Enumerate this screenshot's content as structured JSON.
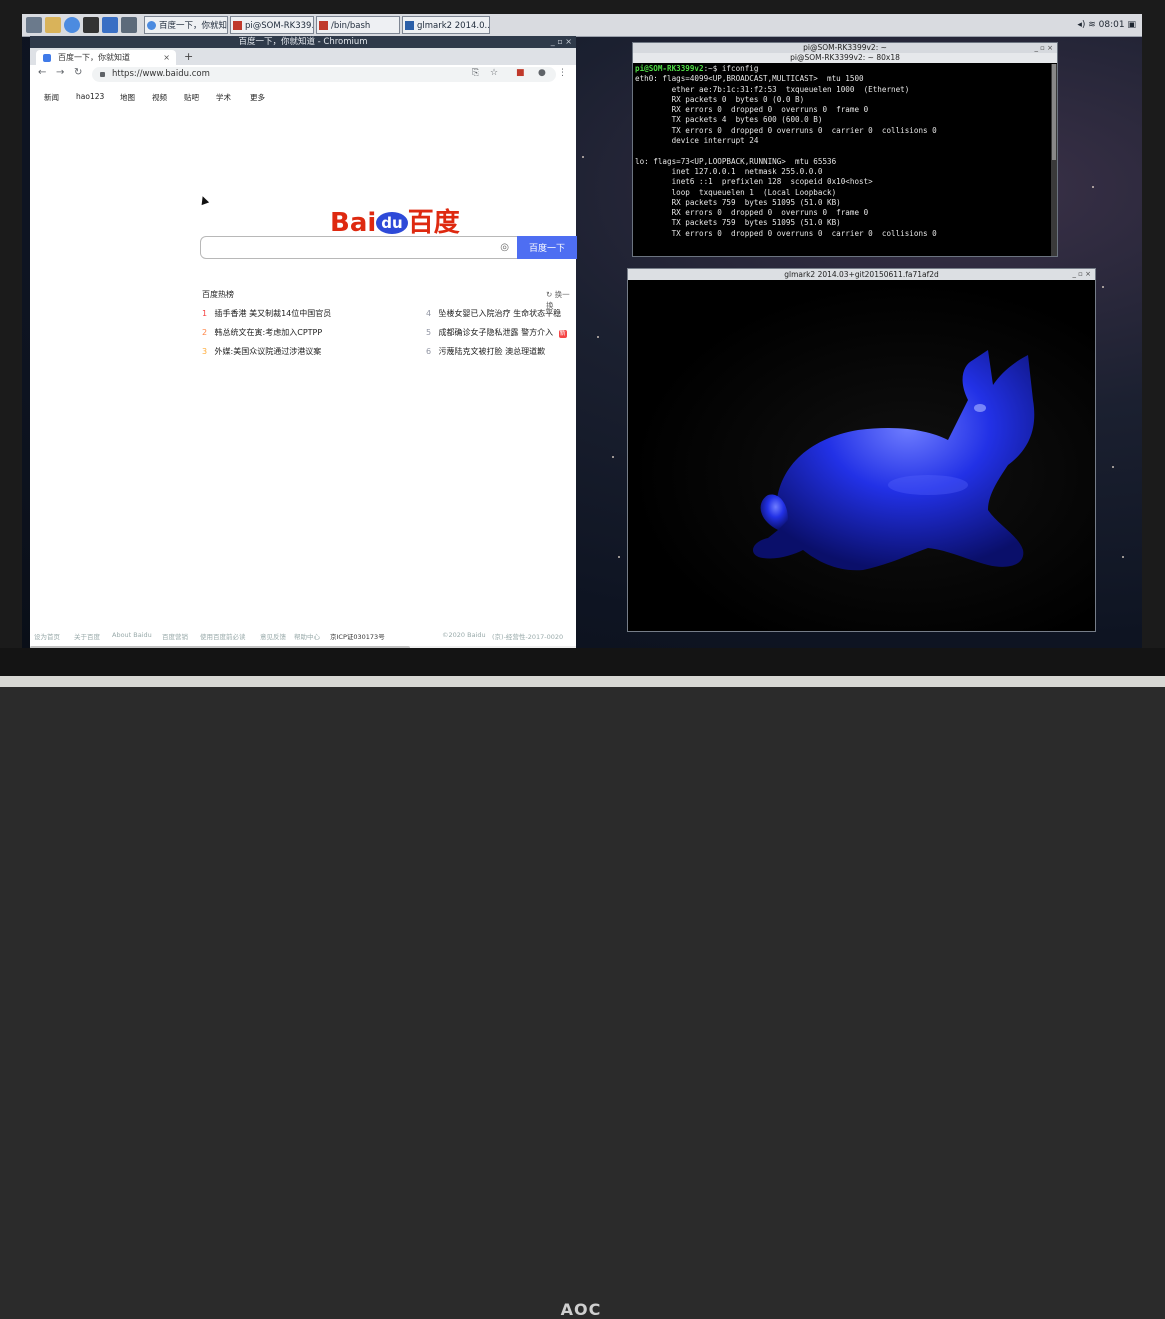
{
  "monitor": {
    "brand": "AOC"
  },
  "taskbar": {
    "buttons": [
      "百度一下，你就知...",
      "pi@SOM-RK339...",
      "/bin/bash",
      "glmark2 2014.0..."
    ],
    "clock": "08:01"
  },
  "chromium": {
    "window_title": "百度一下，你就知道 - Chromium",
    "tab_title": "百度一下，你就知道",
    "tab_close": "×",
    "new_tab": "+",
    "url": "https://www.baidu.com",
    "nav_links": [
      "新闻",
      "hao123",
      "地图",
      "视频",
      "贴吧",
      "学术",
      "更多"
    ],
    "logo": {
      "bai": "Bai",
      "du": "du",
      "cn": "百度"
    },
    "search": {
      "placeholder": "",
      "button": "百度一下"
    },
    "hot_title": "百度热榜",
    "hot_refresh": "换一换",
    "hot_items": [
      {
        "rank": "1",
        "text": "插手香港 美又制裁14位中国官员"
      },
      {
        "rank": "2",
        "text": "韩总统文在寅:考虑加入CPTPP"
      },
      {
        "rank": "3",
        "text": "外媒:美国众议院通过涉港议案"
      },
      {
        "rank": "4",
        "text": "坠楼女婴已入院治疗 生命状态平稳"
      },
      {
        "rank": "5",
        "text": "成都确诊女子隐私泄露 警方介入",
        "badge": "新"
      },
      {
        "rank": "6",
        "text": "污蔑陆克文被打脸 澳总理道歉"
      }
    ],
    "footer": [
      "设为首页",
      "关于百度",
      "About Baidu",
      "百度营销",
      "使用百度前必读",
      "意见反馈",
      "帮助中心",
      "京ICP证030173号",
      "©2020 Baidu",
      "(京)-经营性-2017-0020"
    ]
  },
  "terminal": {
    "title": "pi@SOM-RK3399v2: ~",
    "subtitle": "pi@SOM-RK3399v2: ~ 80x18",
    "prompt": "pi@SOM-RK3399v2",
    "command": ":~$ ifconfig",
    "lines": [
      "eth0: flags=4099<UP,BROADCAST,MULTICAST>  mtu 1500",
      "        ether ae:7b:1c:31:f2:53  txqueuelen 1000  (Ethernet)",
      "        RX packets 0  bytes 0 (0.0 B)",
      "        RX errors 0  dropped 0  overruns 0  frame 0",
      "        TX packets 4  bytes 600 (600.0 B)",
      "        TX errors 0  dropped 0 overruns 0  carrier 0  collisions 0",
      "        device interrupt 24",
      "",
      "lo: flags=73<UP,LOOPBACK,RUNNING>  mtu 65536",
      "        inet 127.0.0.1  netmask 255.0.0.0",
      "        inet6 ::1  prefixlen 128  scopeid 0x10<host>",
      "        loop  txqueuelen 1  (Local Loopback)",
      "        RX packets 759  bytes 51095 (51.0 KB)",
      "        RX errors 0  dropped 0  overruns 0  frame 0",
      "        TX packets 759  bytes 51095 (51.0 KB)",
      "        TX errors 0  dropped 0 overruns 0  carrier 0  collisions 0"
    ]
  },
  "glmark": {
    "title": "glmark2 2014.03+git20150611.fa71af2d"
  },
  "colors": {
    "baidu_red": "#de2910",
    "baidu_blue": "#2e4ad8",
    "search_btn": "#4e6ef2",
    "prompt_green": "#4fdc45",
    "cat_blue": "#2231e6"
  }
}
